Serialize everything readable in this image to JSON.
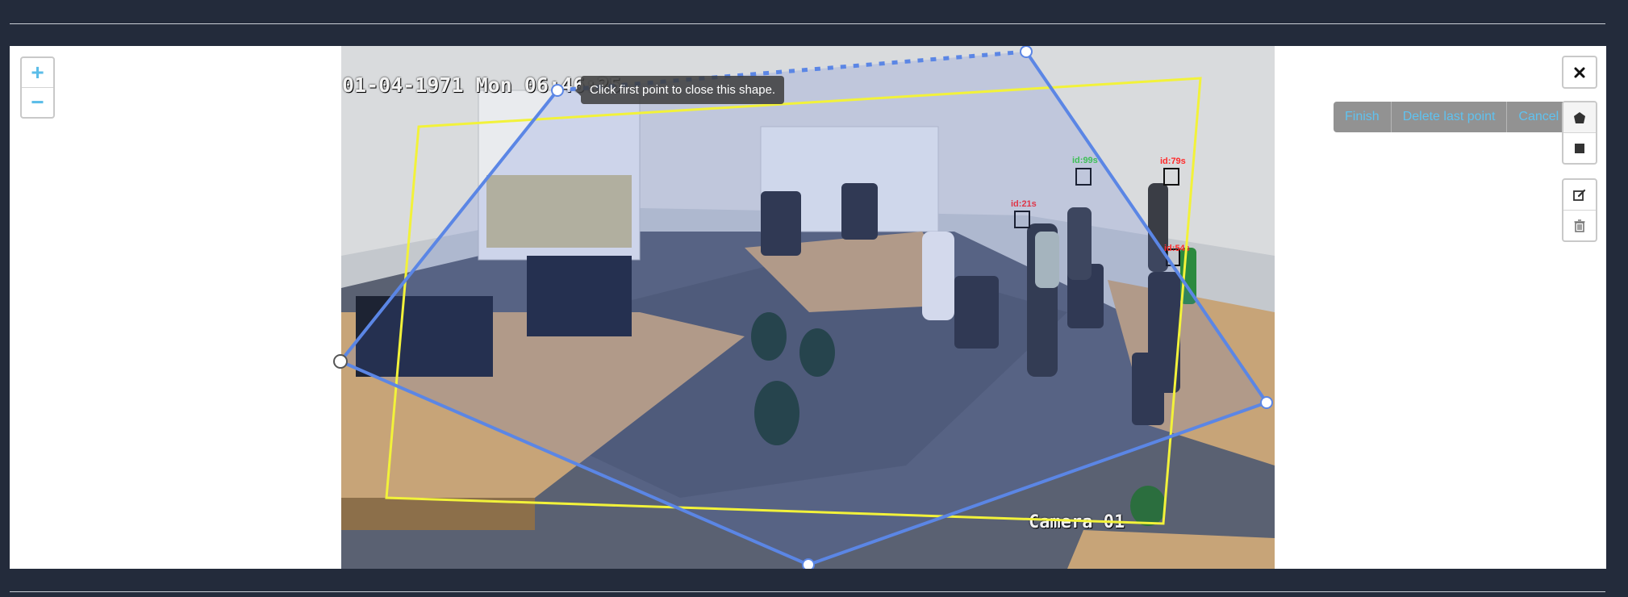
{
  "zoom": {
    "in_label": "+",
    "out_label": "−"
  },
  "camera": {
    "timestamp": "01-04-1971 Mon 06:46:25",
    "name": "Camera 01",
    "detections": [
      {
        "label": "id:99s",
        "color": "#3bd13b"
      },
      {
        "label": "id:79s",
        "color": "#ff2a2a"
      },
      {
        "label": "id:21s",
        "color": "#ff2a2a"
      },
      {
        "label": "id:54s",
        "color": "#ff2a2a"
      }
    ]
  },
  "draw": {
    "tooltip": "Click first point to close this shape.",
    "actions": [
      "Finish",
      "Delete last point",
      "Cancel"
    ]
  },
  "tools": {
    "close": "close-icon",
    "polygon": "polygon-icon",
    "rectangle": "rectangle-icon",
    "edit": "edit-icon",
    "delete": "trash-icon"
  },
  "colors": {
    "drawing_polygon": "#5b86e5",
    "zone_polygon": "#f2f23a",
    "accent": "#5fc2f0",
    "background": "#232b3b"
  }
}
